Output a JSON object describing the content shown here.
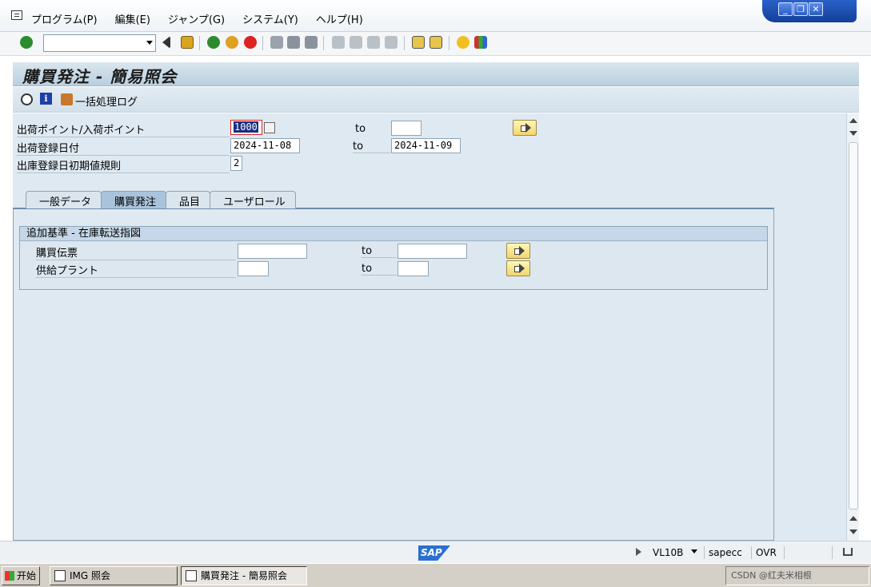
{
  "menubar": {
    "items": [
      "プログラム(P)",
      "編集(E)",
      "ジャンプ(G)",
      "システム(Y)",
      "ヘルプ(H)"
    ]
  },
  "window_controls": {
    "minimize": "_",
    "restore": "❐",
    "close": "✕"
  },
  "toolbar": {
    "command_field_value": ""
  },
  "title": "購買発注 - 簡易照会",
  "app_toolbar": {
    "batch_log_label": "一括処理ログ"
  },
  "selection": {
    "shipping_point": {
      "label": "出荷ポイント/入荷ポイント",
      "from": "1000",
      "to_label": "to",
      "to": ""
    },
    "delivery_date": {
      "label": "出荷登録日付",
      "from": "2024-11-08",
      "to_label": "to",
      "to": "2024-11-09"
    },
    "date_rule": {
      "label": "出庫登録日初期値規則",
      "value": "2"
    }
  },
  "tabs": [
    {
      "label": "一般データ",
      "active": false
    },
    {
      "label": "購買発注",
      "active": true
    },
    {
      "label": "品目",
      "active": false
    },
    {
      "label": "ユーザロール",
      "active": false
    }
  ],
  "group": {
    "title": "追加基準 - 在庫転送指図",
    "rows": [
      {
        "label": "購買伝票",
        "to_label": "to",
        "from": "",
        "to": ""
      },
      {
        "label": "供給プラント",
        "to_label": "to",
        "from": "",
        "to": ""
      }
    ]
  },
  "statusbar": {
    "logo": "SAP",
    "transaction": "VL10B",
    "server": "sapecc",
    "mode": "OVR"
  },
  "taskbar": {
    "start_label": "开始",
    "tasks": [
      {
        "label": "IMG 照会",
        "active": false
      },
      {
        "label": "購買発注 - 簡易照会",
        "active": true
      }
    ],
    "tray_text": "CSDN @红夫米相根"
  },
  "colors": {
    "content_bg": "#dfe9f1",
    "title_bg": "#b9cfde",
    "focus_border": "#dd2222",
    "selected_text_bg": "#1a2f82"
  }
}
